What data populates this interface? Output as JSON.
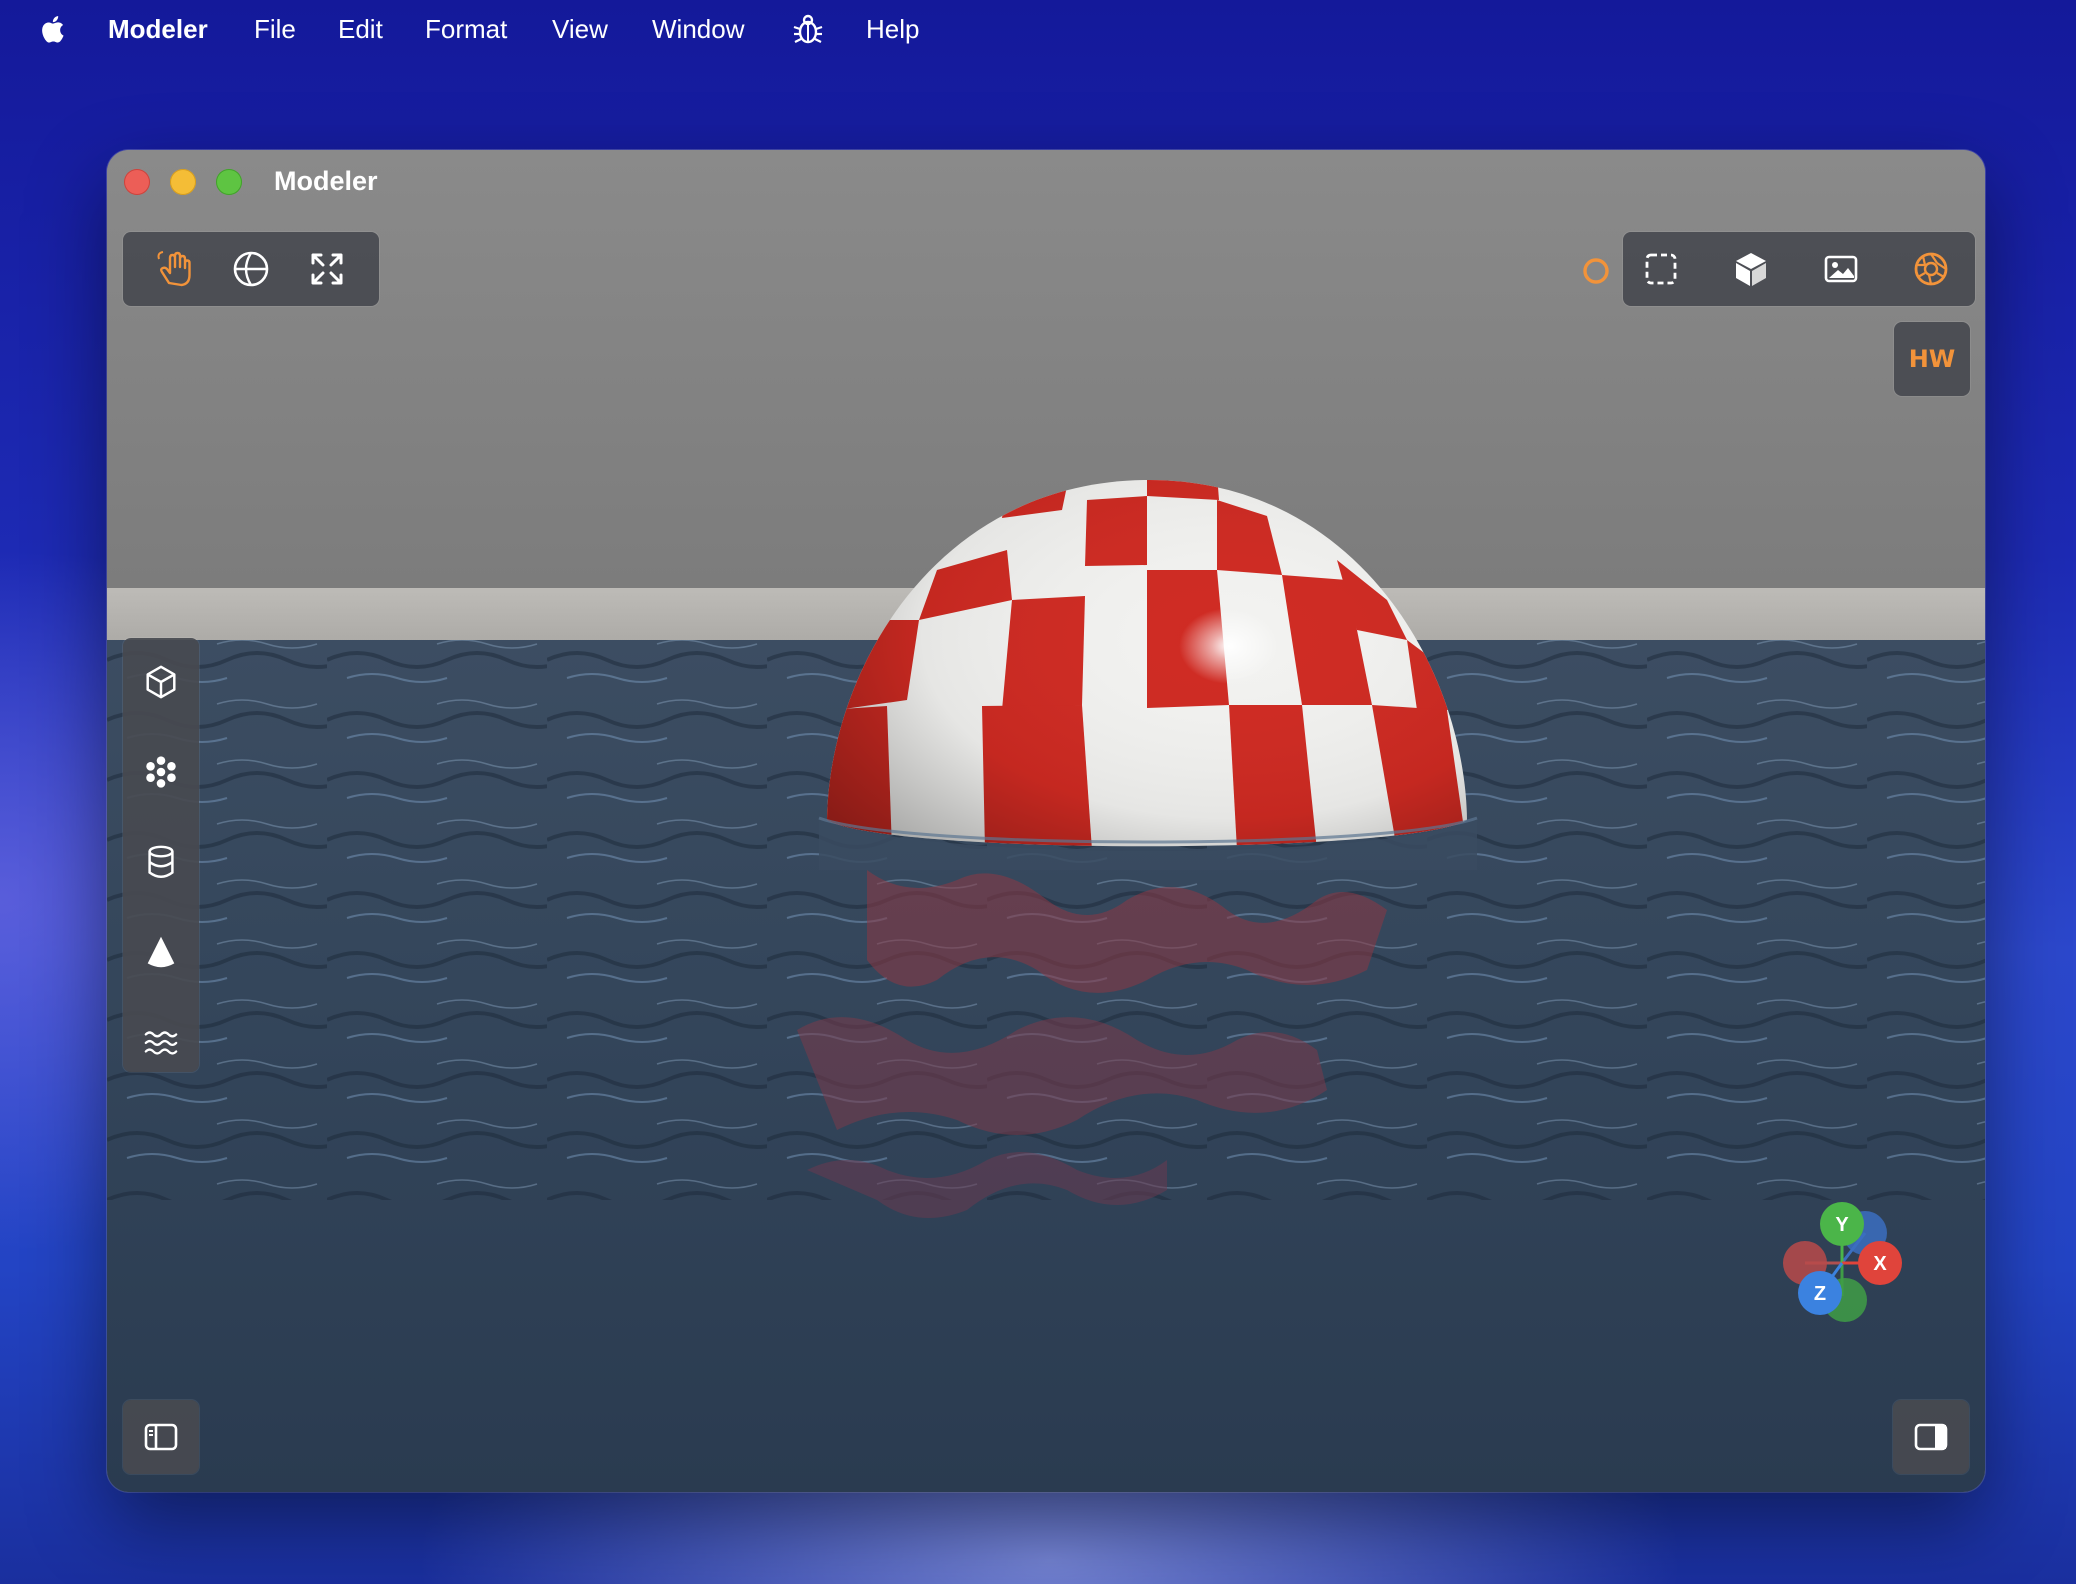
{
  "menubar": {
    "app": "Modeler",
    "items": [
      "File",
      "Edit",
      "Format",
      "View",
      "Window",
      "Help"
    ],
    "icons": [
      "apple-icon",
      "bug-icon"
    ]
  },
  "window": {
    "title": "Modeler"
  },
  "toolbar_left": {
    "tools": [
      "hand-pan-icon",
      "orbit-globe-icon",
      "fit-view-icon"
    ],
    "active_color": "#f2933a"
  },
  "toolbar_right": {
    "status": "loading-ring-icon",
    "tools": [
      "selection-marquee-icon",
      "solid-cube-icon",
      "image-icon",
      "render-aperture-icon"
    ],
    "hw_badge": "HW"
  },
  "shape_palette": [
    "cube-icon",
    "particles-icon",
    "cylinder-icon",
    "cone-icon",
    "water-waves-icon"
  ],
  "axis_gizmo": {
    "x": "X",
    "y": "Y",
    "z": "Z",
    "x_color": "#e0443b",
    "y_color": "#4bb549",
    "z_color": "#3b82e0"
  },
  "bottom_left": "sidebar-left-toggle-icon",
  "bottom_right": "sidebar-right-toggle-icon"
}
